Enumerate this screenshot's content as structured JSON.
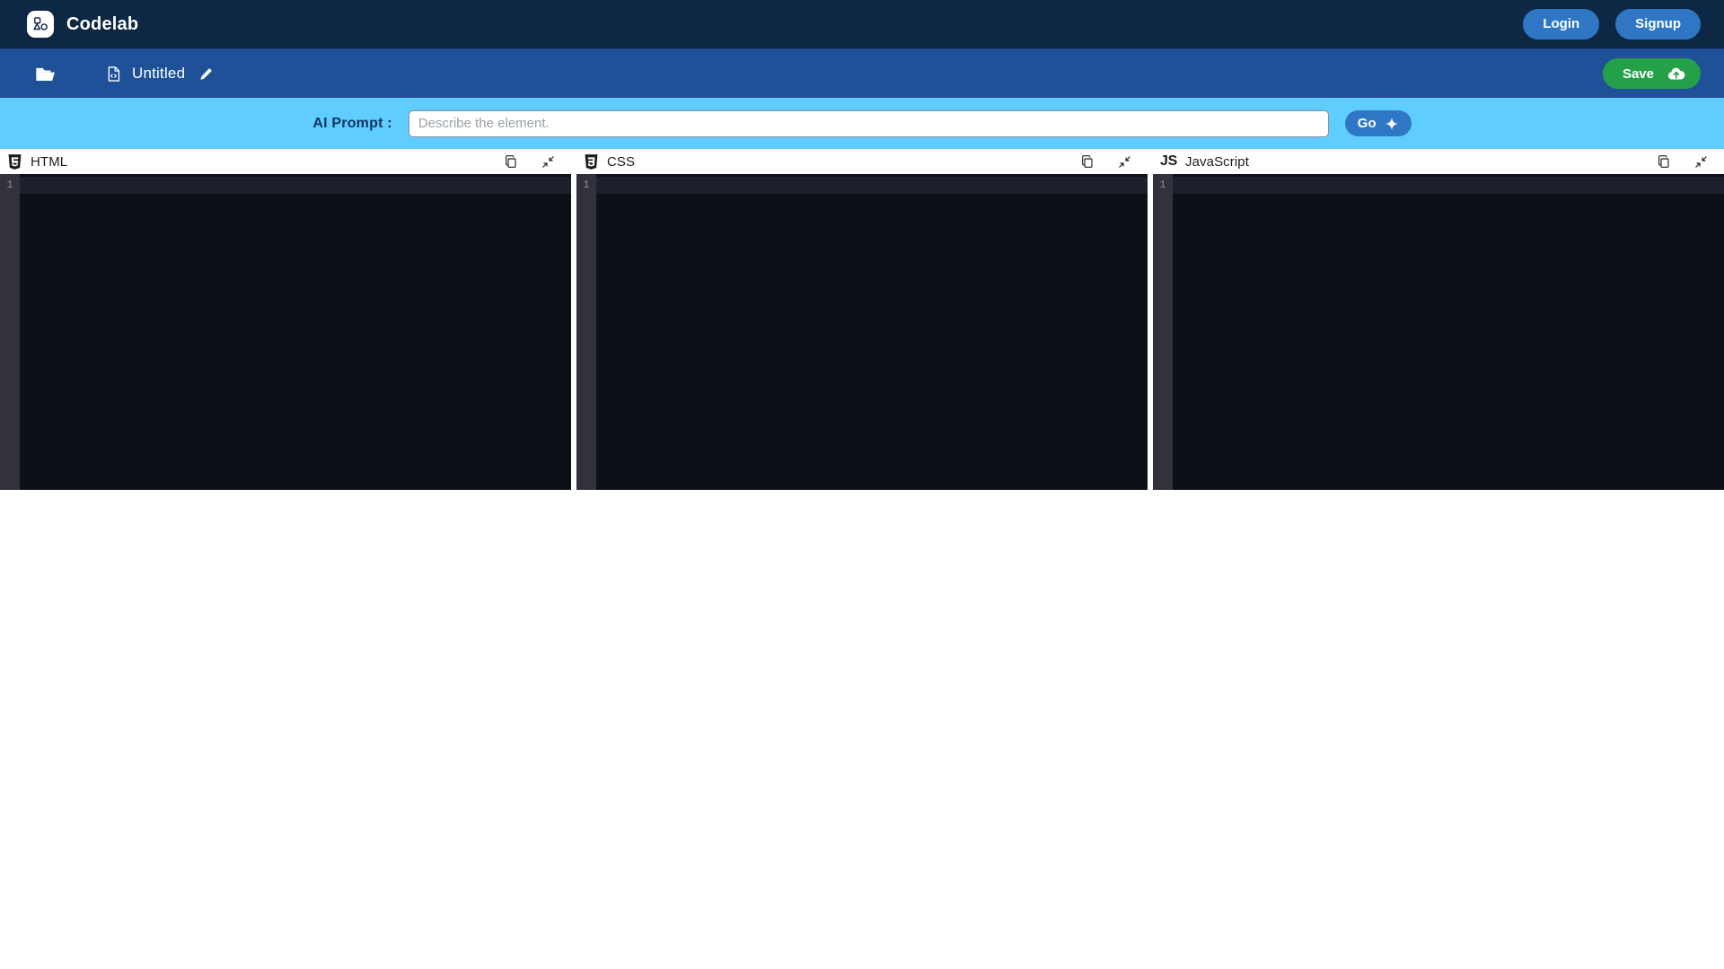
{
  "navbar": {
    "brand_name": "Codelab",
    "logo_icon": "shapes-logo-icon",
    "login_label": "Login",
    "signup_label": "Signup",
    "bg_color": "#0d2744",
    "button_color": "#2f77c4"
  },
  "toolbar": {
    "folder_icon": "folder-open-icon",
    "file_icon": "file-code-icon",
    "file_name": "Untitled",
    "edit_icon": "pencil-icon",
    "save_label": "Save",
    "save_icon": "cloud-upload-icon",
    "save_color": "#24a148",
    "bg_color": "#1f5198"
  },
  "prompt": {
    "label": "AI Prompt :",
    "placeholder": "Describe the element.",
    "value": "",
    "go_label": "Go",
    "go_icon": "sparkle-icon",
    "bg_color": "#5fcdff"
  },
  "editors": [
    {
      "id": "html",
      "title": "HTML",
      "icon": "html5-icon",
      "copy_icon": "copy-icon",
      "collapse_icon": "collapse-icon",
      "line_numbers": [
        "1"
      ],
      "code": ""
    },
    {
      "id": "css",
      "title": "CSS",
      "icon": "css3-icon",
      "copy_icon": "copy-icon",
      "collapse_icon": "collapse-icon",
      "line_numbers": [
        "1"
      ],
      "code": ""
    },
    {
      "id": "javascript",
      "title": "JavaScript",
      "icon": "js-icon",
      "icon_label": "JS",
      "copy_icon": "copy-icon",
      "collapse_icon": "collapse-icon",
      "line_numbers": [
        "1"
      ],
      "code": ""
    }
  ]
}
